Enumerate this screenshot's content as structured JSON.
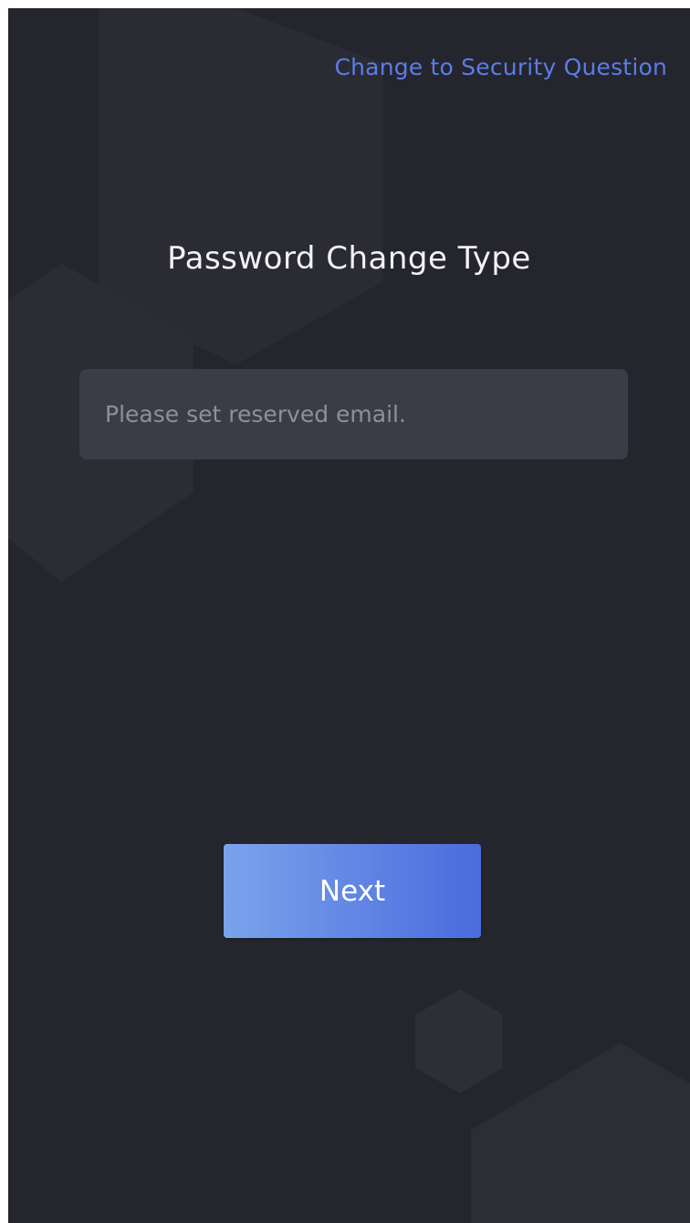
{
  "header": {
    "switch_link_label": "Change to Security Question"
  },
  "main": {
    "title": "Password Change Type",
    "email_input": {
      "value": "",
      "placeholder": "Please set reserved email."
    },
    "next_button_label": "Next"
  },
  "colors": {
    "background": "#24252d",
    "link": "#5b7de6",
    "input_background": "#3b3c48",
    "button_gradient_start": "#7aa3eb",
    "button_gradient_end": "#4a6bdd"
  }
}
